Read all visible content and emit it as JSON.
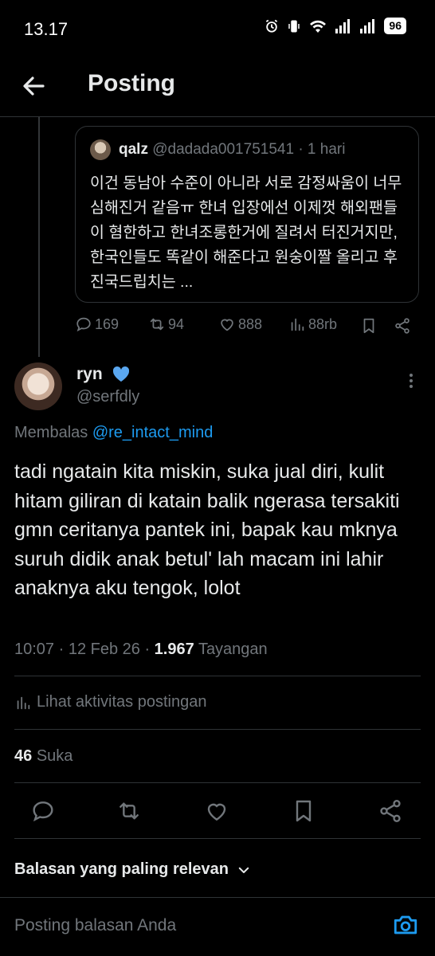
{
  "status_bar": {
    "time": "13.17",
    "battery": "96"
  },
  "header": {
    "title": "Posting"
  },
  "quote": {
    "name": "qalz",
    "handle": "@dadada001751541",
    "time": "· 1 hari",
    "text": "이건 동남아 수준이 아니라 서로 감정싸움이 너무 심해진거 같음ㅠ 한녀 입장에선 이제껏 해외팬들이 혐한하고 한녀조롱한거에 질려서 터진거지만, 한국인들도 똑같이 해준다고 원숭이짤 올리고 후진국드립치는 ..."
  },
  "parent_actions": {
    "replies": "169",
    "reposts": "94",
    "likes": "888",
    "views": "88rb"
  },
  "tweet": {
    "name": "ryn",
    "handle": "@serfdly",
    "reply_prefix": "Membalas",
    "reply_handle": "@re_intact_mind",
    "text": "tadi ngatain kita miskin, suka jual diri, kulit hitam giliran di katain balik ngerasa tersakiti gmn ceritanya pantek ini, bapak kau mknya suruh didik anak betul' lah macam ini lahir anaknya aku tengok, lolot",
    "time": "10:07 · 12 Feb 26 ·",
    "views_count": "1.967",
    "views_label": "Tayangan",
    "activity_label": "Lihat aktivitas postingan",
    "likes_count": "46",
    "likes_label": "Suka"
  },
  "sort_label": "Balasan yang paling relevan",
  "compose_placeholder": "Posting balasan Anda",
  "colors": {
    "accent": "#1d9bf0",
    "muted": "#71767b",
    "text": "#e7e9ea",
    "background": "#000000"
  }
}
